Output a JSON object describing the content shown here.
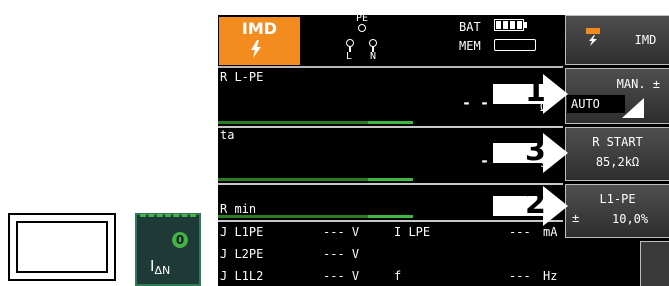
{
  "idn_button": {
    "label_main": "I",
    "label_sub": "ΔN",
    "badge": "0"
  },
  "header": {
    "mode": "IMD",
    "pe": "PE",
    "l": "L",
    "n": "N",
    "bat": "BAT",
    "mem": "MEM"
  },
  "rows": {
    "r_lpe": {
      "label": "R L-PE",
      "value": "- - ·",
      "unit_hint": "Ω"
    },
    "ta": {
      "label": "ta",
      "value": "-",
      "unit_hint": "s"
    },
    "r_min": {
      "label": "R min"
    }
  },
  "measurements": [
    {
      "label": "J L1PE",
      "value": "--- V",
      "label2": "I LPE",
      "value2": "---",
      "unit2": "mA"
    },
    {
      "label": "J L2PE",
      "value": "--- V",
      "label2": "",
      "value2": "",
      "unit2": ""
    },
    {
      "label": "J L1L2",
      "value": "--- V",
      "label2": "f",
      "value2": "---",
      "unit2": "Hz"
    }
  ],
  "softkeys": {
    "mode": {
      "label": "IMD"
    },
    "man_auto": {
      "line1": "MAN. ±",
      "line2": "AUTO"
    },
    "r_start": {
      "line1": "R START",
      "line2": "85,2kΩ"
    },
    "l1pe": {
      "line1": "L1-PE",
      "pm": "±",
      "value": "10,0%"
    }
  },
  "callouts": [
    "1",
    "3",
    "2"
  ],
  "colors": {
    "accent": "#f28c1e",
    "screen": "#000000",
    "bar_green": "#3fb83f",
    "idn_bg": "#1d3a37"
  }
}
